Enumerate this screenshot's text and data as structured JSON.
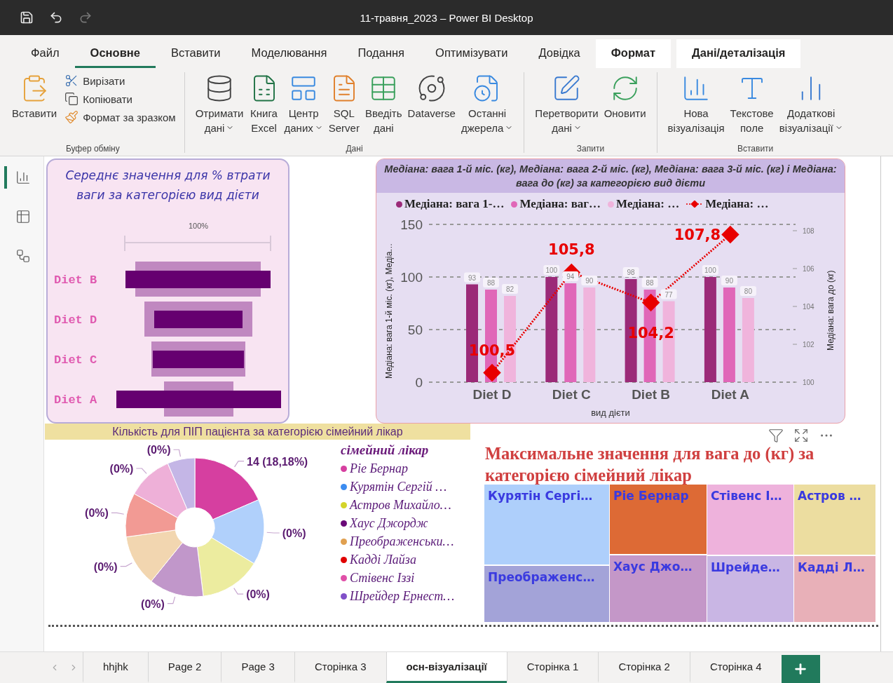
{
  "window": {
    "title": "11-травня_2023 – Power BI Desktop"
  },
  "ribbon_tabs": [
    {
      "label": "Файл",
      "selected": false,
      "contextual": false
    },
    {
      "label": "Основне",
      "selected": true,
      "contextual": false
    },
    {
      "label": "Вставити",
      "selected": false,
      "contextual": false
    },
    {
      "label": "Моделювання",
      "selected": false,
      "contextual": false
    },
    {
      "label": "Подання",
      "selected": false,
      "contextual": false
    },
    {
      "label": "Оптимізувати",
      "selected": false,
      "contextual": false
    },
    {
      "label": "Довідка",
      "selected": false,
      "contextual": false
    },
    {
      "label": "Формат",
      "selected": false,
      "contextual": true
    },
    {
      "label": "Дані/деталізація",
      "selected": false,
      "contextual": true
    }
  ],
  "ribbon_groups": [
    {
      "label": "Буфер обміну",
      "buttons": [
        {
          "kind": "large",
          "lines": [
            "Вставити"
          ],
          "dropdown": false
        },
        {
          "kind": "small",
          "lines": [
            "Вирізати"
          ],
          "dropdown": false
        },
        {
          "kind": "small",
          "lines": [
            "Копіювати"
          ],
          "dropdown": false
        },
        {
          "kind": "small",
          "lines": [
            "Формат за зразком"
          ],
          "dropdown": false
        }
      ]
    },
    {
      "label": "Дані",
      "buttons": [
        {
          "kind": "large",
          "lines": [
            "Отримати",
            "дані"
          ],
          "dropdown": true
        },
        {
          "kind": "large",
          "lines": [
            "Книга",
            "Excel"
          ],
          "dropdown": false
        },
        {
          "kind": "large",
          "lines": [
            "Центр",
            "даних"
          ],
          "dropdown": true
        },
        {
          "kind": "large",
          "lines": [
            "SQL",
            "Server"
          ],
          "dropdown": false
        },
        {
          "kind": "large",
          "lines": [
            "Введіть",
            "дані"
          ],
          "dropdown": false
        },
        {
          "kind": "large",
          "lines": [
            "Dataverse"
          ],
          "dropdown": false
        },
        {
          "kind": "large",
          "lines": [
            "Останні",
            "джерела"
          ],
          "dropdown": true
        }
      ]
    },
    {
      "label": "Запити",
      "buttons": [
        {
          "kind": "large",
          "lines": [
            "Перетворити",
            "дані"
          ],
          "dropdown": true
        },
        {
          "kind": "large",
          "lines": [
            "Оновити"
          ],
          "dropdown": false
        }
      ]
    },
    {
      "label": "Вставити",
      "buttons": [
        {
          "kind": "large",
          "lines": [
            "Нова",
            "візуалізація"
          ],
          "dropdown": false
        },
        {
          "kind": "large",
          "lines": [
            "Текстове",
            "поле"
          ],
          "dropdown": false
        },
        {
          "kind": "large",
          "lines": [
            "Додаткові",
            "візуалізації"
          ],
          "dropdown": true
        }
      ]
    }
  ],
  "sidebar": [
    {
      "kind": "report",
      "selected": true
    },
    {
      "kind": "data",
      "selected": false
    },
    {
      "kind": "model",
      "selected": false
    }
  ],
  "funnel": {
    "title": "Середнє значення для % втрати ваги за категорією вид дієти",
    "scale_label": "100%",
    "rows": [
      {
        "label": "Diet B"
      },
      {
        "label": "Diet D"
      },
      {
        "label": "Diet C"
      },
      {
        "label": "Diet A"
      }
    ]
  },
  "bar_chart": {
    "chart_data": {
      "type": "bar",
      "title": "Медіана: вага 1-й міс. (кг), Медіана: вага 2-й міс. (кг), Медіана: вага 3-й міс. (кг) і Медіана: вага до (кг) за категорією вид дієти",
      "xlabel": "вид дієти",
      "ylabel": "Медіана: вага 1-й міс. (кг), Медіа…",
      "y2label": "Медіана: вага до (кг)",
      "categories": [
        "Diet D",
        "Diet C",
        "Diet B",
        "Diet A"
      ],
      "series": [
        {
          "name": "Медіана: вага 1-…",
          "type": "bar",
          "color": "#9b2a78",
          "values": [
            93,
            100,
            98,
            100
          ],
          "value_labels": [
            "93",
            "100",
            "98",
            "100"
          ]
        },
        {
          "name": "Медіана: ваг…",
          "type": "bar",
          "color": "#e067b8",
          "values": [
            88,
            94,
            88,
            90
          ],
          "value_labels": [
            "88",
            "94",
            "88",
            "90"
          ]
        },
        {
          "name": "Медіана: …",
          "type": "bar",
          "color": "#f0b4dc",
          "values": [
            82,
            90,
            77,
            80
          ],
          "value_labels": [
            "82",
            "90",
            "77",
            "80"
          ]
        },
        {
          "name": "Медіана: …",
          "type": "line",
          "axis": "y2",
          "line_style": "dotted",
          "marker": "diamond",
          "color": "#e80000",
          "values": [
            100.5,
            105.8,
            104.2,
            107.8
          ],
          "value_labels": [
            "100,5",
            "105,8",
            "104,2",
            "107,8"
          ]
        }
      ],
      "ylim": [
        0,
        150
      ],
      "yticks": [
        0,
        50,
        100,
        150
      ],
      "y2lim": [
        100,
        108
      ],
      "y2ticks": [
        100,
        102,
        104,
        106,
        108
      ],
      "stacked": false
    }
  },
  "pie": {
    "title": "Кількість для ПІП пацієнта за категорією сімейний лікар",
    "slices": [
      {
        "label": "14 (18,18%)",
        "color": "#d63fa0"
      },
      {
        "label": "(0%)",
        "color": "#b0d0fb"
      },
      {
        "label": "(0%)",
        "color": "#ecec9f"
      },
      {
        "label": "(0%)",
        "color": "#c197ca"
      },
      {
        "label": "(0%)",
        "color": "#f2d6b0"
      },
      {
        "label": "(0%)",
        "color": "#f29a94"
      },
      {
        "label": "(0%)",
        "color": "#eeb0d8"
      },
      {
        "label": "(0%)",
        "color": "#c4b6e6"
      }
    ],
    "legend_title": "сімейний лікар",
    "legend": [
      {
        "label": "Ріе Бернар",
        "color": "#d63fa0"
      },
      {
        "label": "Курятін Сергій …",
        "color": "#3b8cf0"
      },
      {
        "label": "Астров Михайло…",
        "color": "#d4d42a"
      },
      {
        "label": "Хаус Джордж",
        "color": "#6a0a78"
      },
      {
        "label": "Преображенськи…",
        "color": "#e0a050"
      },
      {
        "label": "Кадді Лайза",
        "color": "#e00000"
      },
      {
        "label": "Стівенс Іззі",
        "color": "#e050a8"
      },
      {
        "label": "Шрейдер Ернест…",
        "color": "#8050c8"
      }
    ]
  },
  "treemap": {
    "title": "Максимальне значення для вага до (кг) за категорією сімейний лікар",
    "columns": [
      {
        "tiles": [
          {
            "label": "Курятін Сергі…",
            "color": "#aecffb"
          },
          {
            "label": "Преображенс…",
            "color": "#a3a3d8"
          }
        ]
      },
      {
        "tiles": [
          {
            "label": "Ріе Бернар",
            "color": "#dd6a35"
          },
          {
            "label": "Хаус Джо…",
            "color": "#c497c8"
          }
        ]
      },
      {
        "tiles": [
          {
            "label": "Стівенс І…",
            "color": "#eeb2dc"
          },
          {
            "label": "Шрейде…",
            "color": "#c9b6e4"
          }
        ]
      },
      {
        "tiles": [
          {
            "label": "Астров …",
            "color": "#ecdda0"
          },
          {
            "label": "Кадді Л…",
            "color": "#e8b0b8"
          }
        ]
      }
    ]
  },
  "pages": [
    {
      "label": "hhjhk",
      "selected": false
    },
    {
      "label": "Page 2",
      "selected": false
    },
    {
      "label": "Page 3",
      "selected": false
    },
    {
      "label": "Сторінка 3",
      "selected": false
    },
    {
      "label": "осн-візуалізації",
      "selected": true
    },
    {
      "label": "Сторінка 1",
      "selected": false
    },
    {
      "label": "Сторінка 2",
      "selected": false
    },
    {
      "label": "Сторінка 4",
      "selected": false
    }
  ]
}
